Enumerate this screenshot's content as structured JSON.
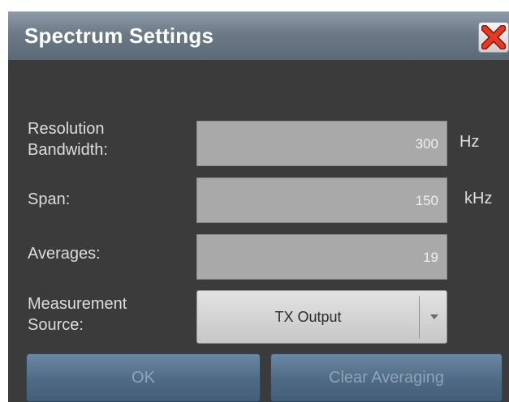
{
  "dialog": {
    "title": "Spectrum Settings",
    "close_icon": "close-x-icon"
  },
  "fields": {
    "resolution_bandwidth": {
      "label_line1": "Resolution",
      "label_line2": "Bandwidth:",
      "value": "300",
      "unit": "Hz"
    },
    "span": {
      "label": "Span:",
      "value": "150",
      "unit": "kHz"
    },
    "averages": {
      "label": "Averages:",
      "value": "19"
    },
    "measurement_source": {
      "label_line1": "Measurement",
      "label_line2": "Source:",
      "selected": "TX Output",
      "dropdown_icon": "chevron-down-icon"
    }
  },
  "buttons": {
    "ok": "OK",
    "clear_averaging": "Clear Averaging"
  },
  "colors": {
    "title_bar": "#6c7a88",
    "body_bg": "#3b3b3b",
    "field_bg": "#a9a9a9",
    "button_bg": "#4f6a84",
    "close_x": "#d12a1a"
  }
}
